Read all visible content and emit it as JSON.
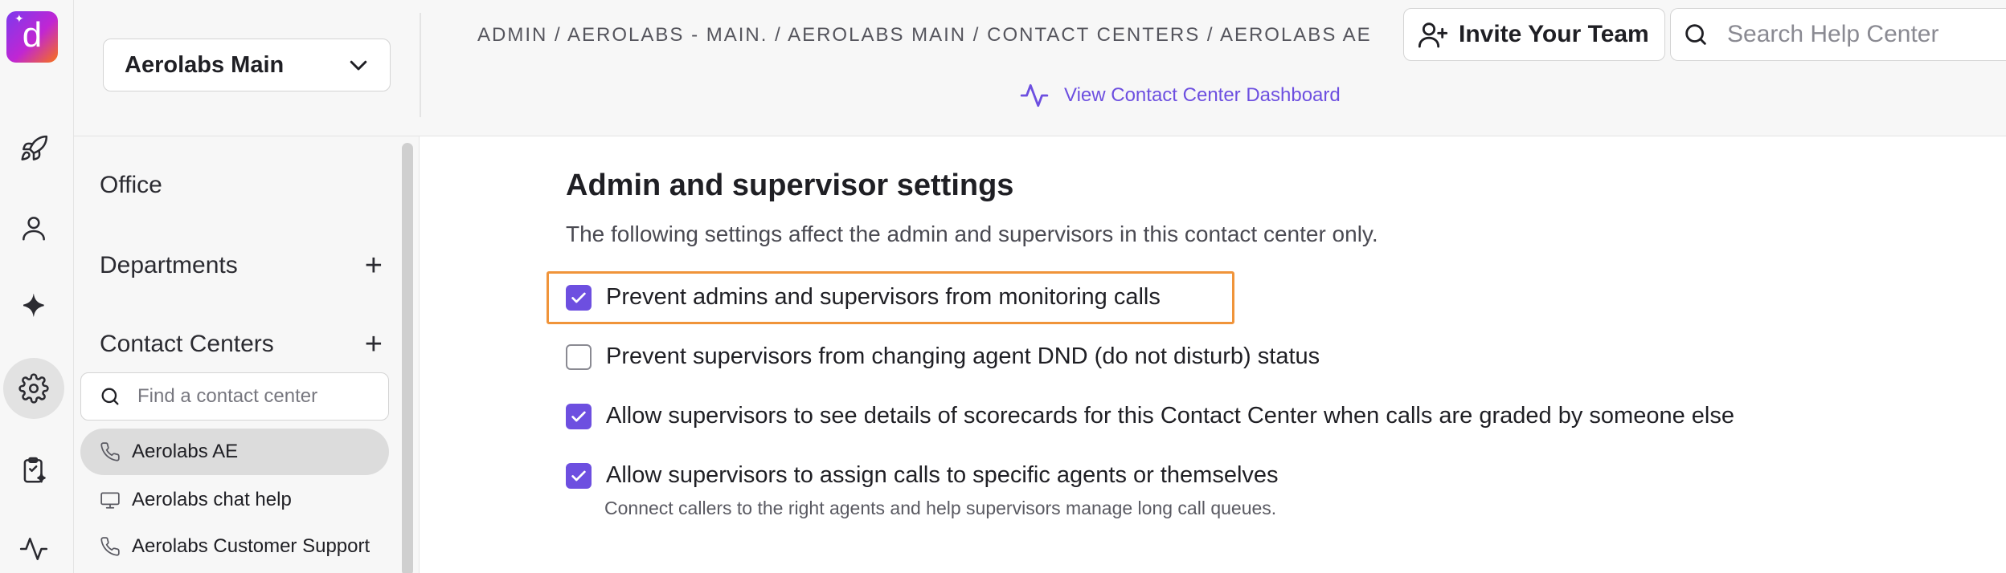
{
  "rail": {
    "logo_letter": "d",
    "items": [
      {
        "icon": "rocket-icon"
      },
      {
        "icon": "person-icon"
      },
      {
        "icon": "sparkle-icon"
      },
      {
        "icon": "gear-icon",
        "active": true
      },
      {
        "icon": "clipboard-sparkle-icon"
      },
      {
        "icon": "activity-icon"
      }
    ]
  },
  "header": {
    "workspace": "Aerolabs Main",
    "breadcrumb": "ADMIN / AEROLABS - MAIN. / AEROLABS MAIN / CONTACT CENTERS / AEROLABS AE",
    "dashboard_link": "View Contact Center Dashboard",
    "invite_label": "Invite Your Team",
    "search_placeholder": "Search Help Center"
  },
  "sidebar": {
    "office": "Office",
    "departments": "Departments",
    "contact_centers": "Contact Centers",
    "cc_search_placeholder": "Find a contact center",
    "items": [
      {
        "label": "Aerolabs AE",
        "icon": "phone-icon",
        "selected": true
      },
      {
        "label": "Aerolabs chat help",
        "icon": "monitor-icon",
        "selected": false
      },
      {
        "label": "Aerolabs Customer Support",
        "icon": "phone-icon",
        "selected": false
      }
    ]
  },
  "main": {
    "title": "Admin and supervisor settings",
    "description": "The following settings affect the admin and supervisors in this contact center only.",
    "settings": [
      {
        "label": "Prevent admins and supervisors from monitoring calls",
        "checked": true
      },
      {
        "label": "Prevent supervisors from changing agent DND (do not disturb) status",
        "checked": false
      },
      {
        "label": "Allow supervisors to see details of scorecards for this Contact Center when calls are graded by someone else",
        "checked": true
      },
      {
        "label": "Allow supervisors to assign calls to specific agents or themselves",
        "checked": true
      }
    ],
    "assign_help": "Connect callers to the right agents and help supervisors manage long call queues."
  },
  "colors": {
    "accent": "#6d4fe0",
    "highlight": "#f0943a"
  }
}
